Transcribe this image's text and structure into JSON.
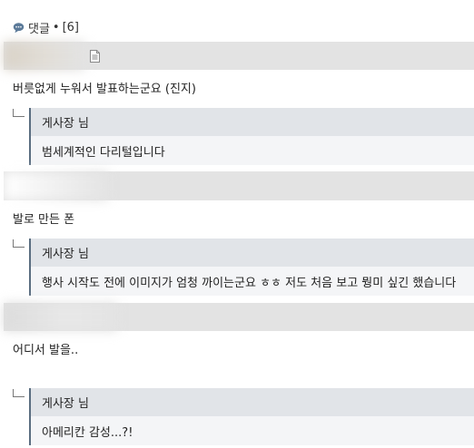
{
  "comments_header": {
    "label": "댓글",
    "separator": "•",
    "count": "[6]"
  },
  "comments": [
    {
      "body": "버릇없게 누워서 발표하는군요 (진지)",
      "reply": {
        "author": "게사장 님",
        "body": "범세계적인 다리털입니다"
      }
    },
    {
      "body": "발로 만든 폰",
      "reply": {
        "author": "게사장 님",
        "body": "행사 시작도 전에 이미지가 엄청 까이는군요 ㅎㅎ 저도 처음 보고 뭥미 싶긴 했습니다"
      }
    },
    {
      "body": "어디서 발을..",
      "reply": {
        "author": "게사장 님",
        "body": "아메리칸 감성...?!"
      }
    }
  ],
  "colors": {
    "band": "#e3e3e3",
    "reply_header": "#e1e4e8",
    "reply_body": "#f4f5f7",
    "reply_border": "#5a6d80",
    "icon": "#5b7a99"
  }
}
